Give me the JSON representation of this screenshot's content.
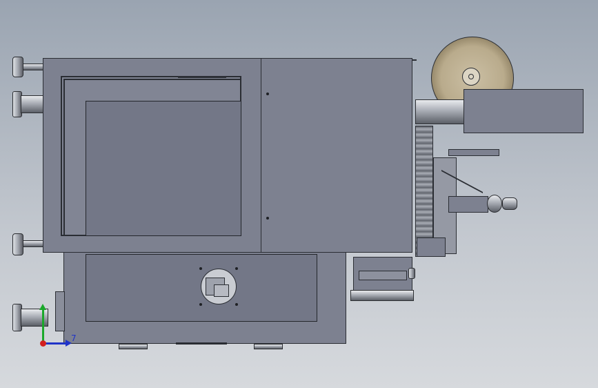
{
  "viewport": {
    "background": "gradient-grey-blue",
    "accent_colors": {
      "x_axis": "#1f33c8",
      "y_axis": "#1aa82a",
      "origin": "#d21f1f"
    }
  },
  "triad": {
    "axis_label": "7"
  }
}
